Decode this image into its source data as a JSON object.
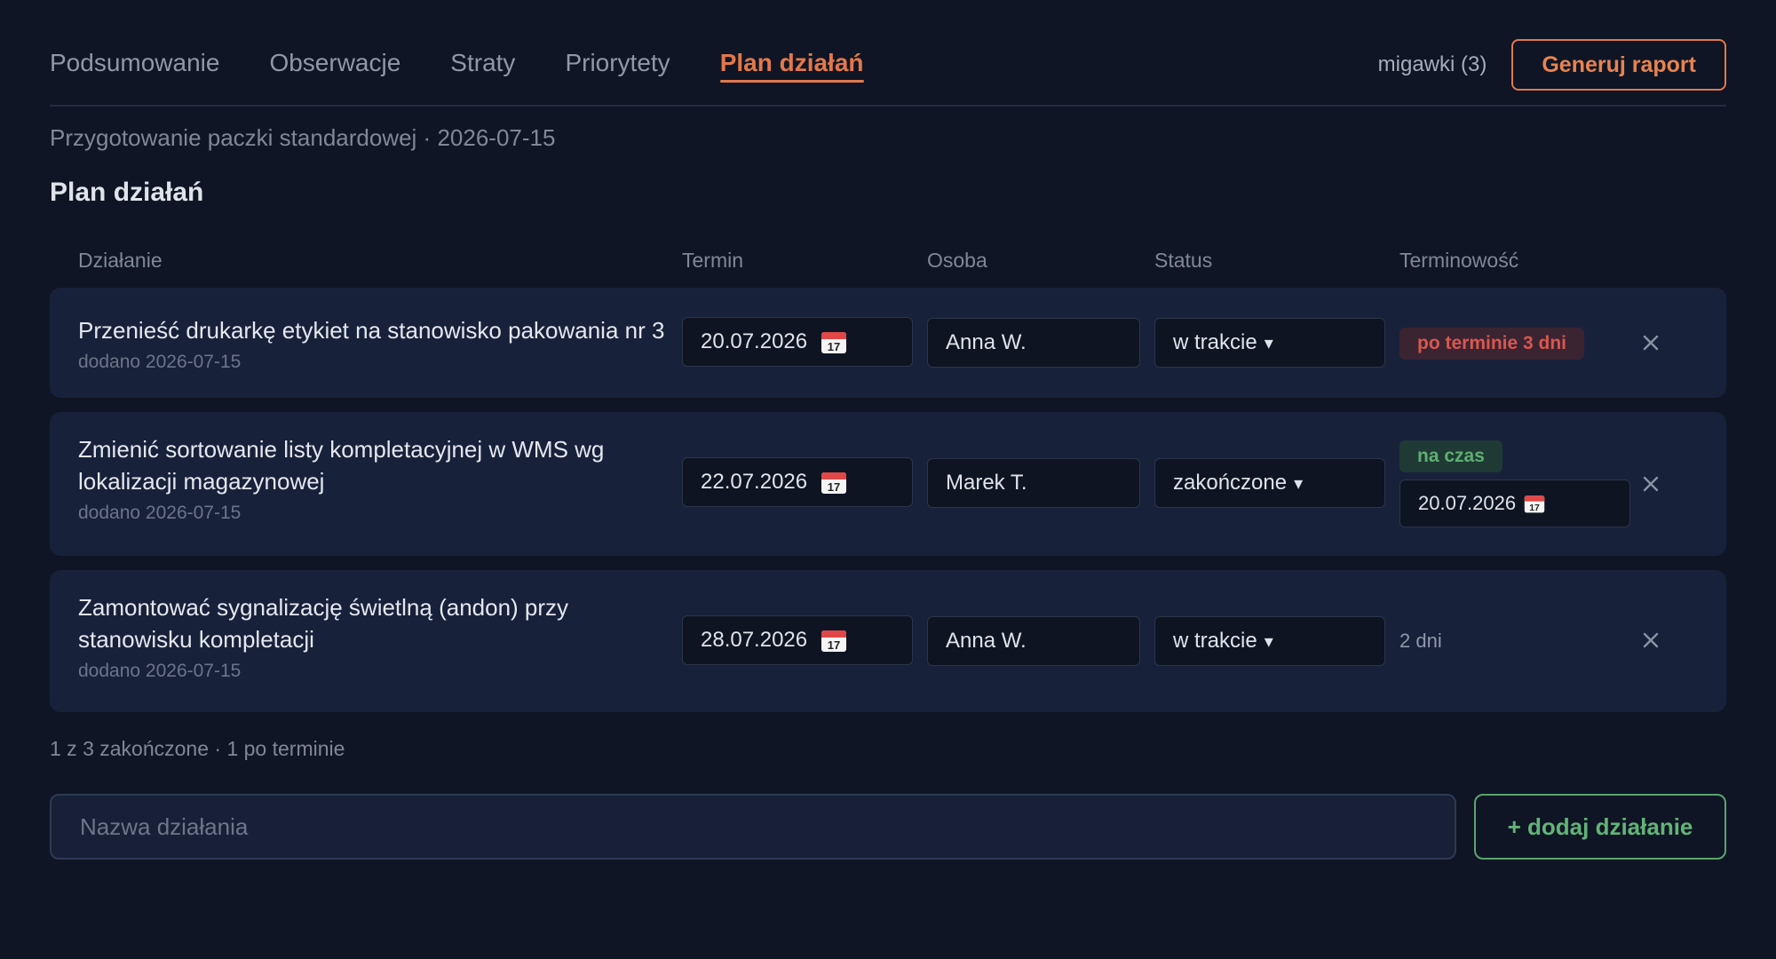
{
  "nav": {
    "tabs": [
      {
        "label": "Podsumowanie"
      },
      {
        "label": "Obserwacje"
      },
      {
        "label": "Straty"
      },
      {
        "label": "Priorytety"
      },
      {
        "label": "Plan działań"
      }
    ],
    "active_tab": "Plan działań",
    "snapshots_label": "migawki (3)",
    "report_button": "Generuj raport"
  },
  "subtitle": "Przygotowanie paczki standardowej · 2026-07-15",
  "section_title": "Plan działań",
  "columns": {
    "action": "Działanie",
    "deadline": "Termin",
    "person": "Osoba",
    "status": "Status",
    "timeliness": "Terminowość"
  },
  "rows": [
    {
      "title": "Przenieść drukarkę etykiet na stanowisko pakowania nr 3",
      "added": "dodano 2026-07-15",
      "deadline": "20.07.2026",
      "person": "Anna W.",
      "status": "w trakcie",
      "timeliness_badge": "po terminie 3 dni"
    },
    {
      "title": "Zmienić sortowanie listy kompletacyjnej w WMS wg lokalizacji magazynowej",
      "added": "dodano 2026-07-15",
      "deadline": "22.07.2026",
      "person": "Marek T.",
      "status": "zakończone",
      "timeliness_badge": "na czas",
      "completed_date": "20.07.2026"
    },
    {
      "title": "Zamontować sygnalizację świetlną (andon) przy stanowisku kompletacji",
      "added": "dodano 2026-07-15",
      "deadline": "28.07.2026",
      "person": "Anna W.",
      "status": "w trakcie",
      "timeliness_text": "2 dni"
    }
  ],
  "summary": "1 z 3 zakończone · 1 po terminie",
  "new_action": {
    "placeholder": "Nazwa działania",
    "add_button": "+ dodaj działanie"
  },
  "icons": {
    "calendar": "calendar-icon",
    "close": "close-icon",
    "dropdown": "chevron-down-icon"
  },
  "colors": {
    "background": "#0f1524",
    "row_background": "#18213a",
    "accent_orange": "#e2784a",
    "late_red": "#d9574f",
    "ontime_green": "#5fae73"
  }
}
